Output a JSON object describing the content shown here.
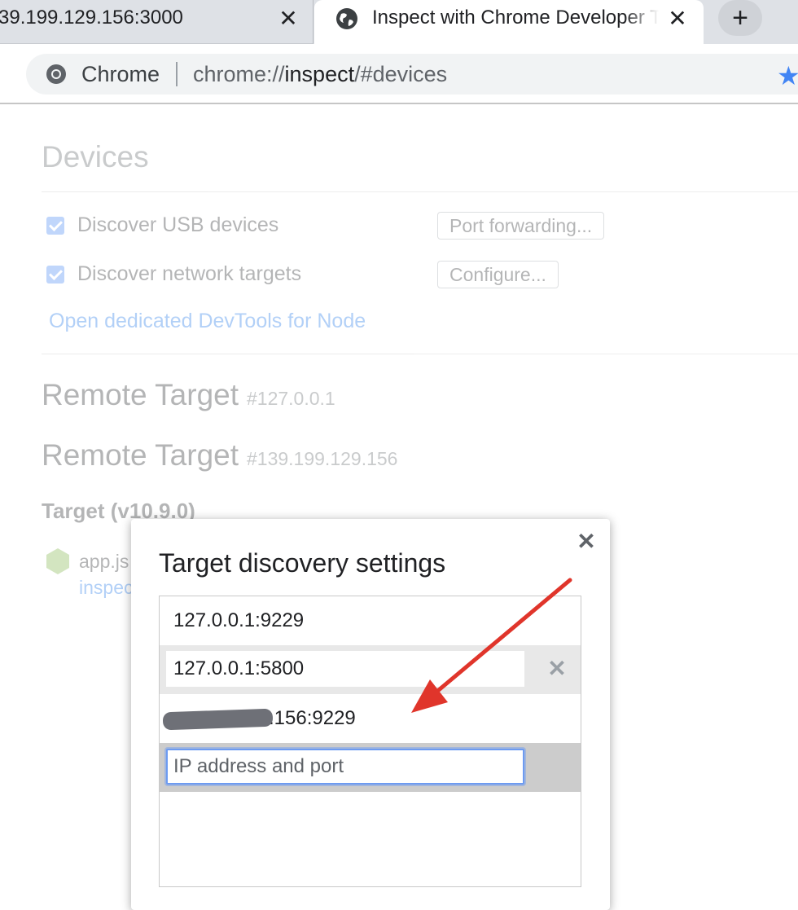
{
  "tabs": [
    {
      "title": "39.199.129.156:3000",
      "close": "✕"
    },
    {
      "title": "Inspect with Chrome Developer Tools",
      "close": "✕"
    }
  ],
  "new_tab_label": "+",
  "omnibox": {
    "label": "Chrome",
    "url_prefix": "chrome://",
    "url_host": "inspect",
    "url_suffix": "/#devices"
  },
  "page": {
    "devices_heading": "Devices",
    "discover_usb": "Discover USB devices",
    "port_forwarding_button": "Port forwarding...",
    "discover_network": "Discover network targets",
    "configure_button": "Configure...",
    "open_devtools_link": "Open dedicated DevTools for Node",
    "remote_targets": [
      {
        "label": "Remote Target",
        "host": "#127.0.0.1"
      },
      {
        "label": "Remote Target",
        "host": "#139.199.129.156"
      }
    ],
    "target_heading": "Target (v10.9.0)",
    "app_name": "app.js",
    "inspect_link": "inspect"
  },
  "dialog": {
    "title": "Target discovery settings",
    "close": "✕",
    "entries": [
      "127.0.0.1:9229",
      "127.0.0.1:5800",
      "139.199.129.156:9229"
    ],
    "visible_partial_entry": ".156:9229",
    "remove_icon": "✕",
    "new_entry_placeholder": "IP address and port"
  },
  "colors": {
    "accent": "#4285f4",
    "annotation_arrow": "#e0352b",
    "tab_strip": "#dee1e6"
  }
}
